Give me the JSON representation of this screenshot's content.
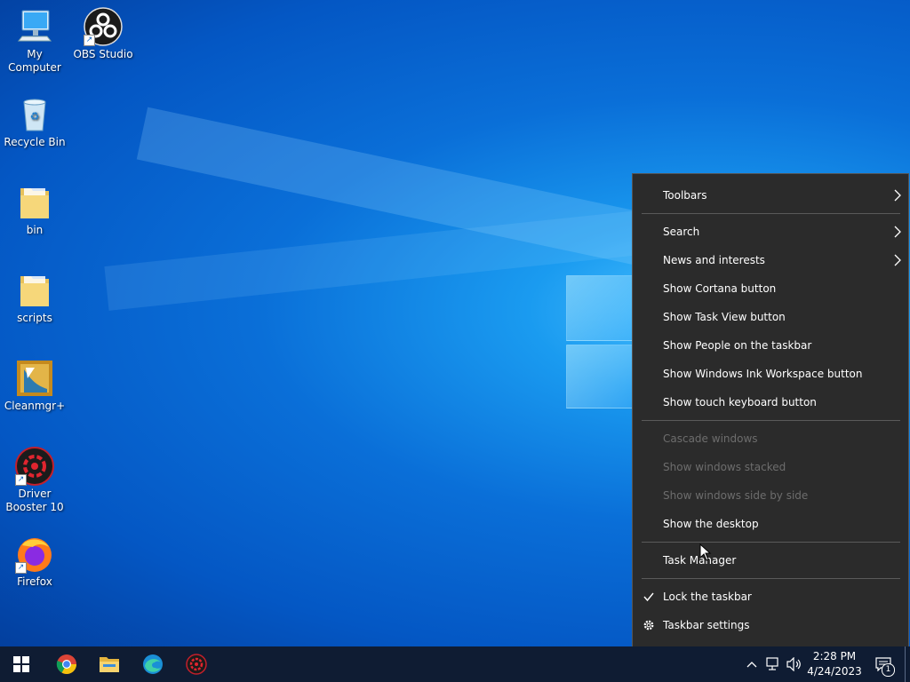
{
  "desktop": {
    "icons": [
      {
        "label": "My Computer",
        "icon": "computer-icon",
        "shortcut": false
      },
      {
        "label": "OBS Studio",
        "icon": "obs-icon",
        "shortcut": true
      },
      {
        "label": "Recycle Bin",
        "icon": "recycle-bin-icon",
        "shortcut": false
      },
      {
        "label": "bin",
        "icon": "folder-icon",
        "shortcut": false
      },
      {
        "label": "scripts",
        "icon": "folder-icon",
        "shortcut": false
      },
      {
        "label": "Cleanmgr+",
        "icon": "cleanmgr-icon",
        "shortcut": false
      },
      {
        "label": "Driver Booster 10",
        "icon": "driver-booster-icon",
        "shortcut": true
      },
      {
        "label": "Firefox",
        "icon": "firefox-icon",
        "shortcut": true
      }
    ]
  },
  "context_menu": {
    "items": [
      {
        "label": "Toolbars",
        "submenu": true,
        "enabled": true
      },
      {
        "label": "Search",
        "submenu": true,
        "enabled": true
      },
      {
        "label": "News and interests",
        "submenu": true,
        "enabled": true
      },
      {
        "label": "Show Cortana button",
        "enabled": true
      },
      {
        "label": "Show Task View button",
        "enabled": true
      },
      {
        "label": "Show People on the taskbar",
        "enabled": true
      },
      {
        "label": "Show Windows Ink Workspace button",
        "enabled": true
      },
      {
        "label": "Show touch keyboard button",
        "enabled": true
      },
      {
        "label": "Cascade windows",
        "enabled": false
      },
      {
        "label": "Show windows stacked",
        "enabled": false
      },
      {
        "label": "Show windows side by side",
        "enabled": false
      },
      {
        "label": "Show the desktop",
        "enabled": true
      },
      {
        "label": "Task Manager",
        "enabled": true
      },
      {
        "label": "Lock the taskbar",
        "checked": true,
        "enabled": true
      },
      {
        "label": "Taskbar settings",
        "icon": "gear-icon",
        "enabled": true
      }
    ]
  },
  "taskbar": {
    "pinned": [
      {
        "name": "start-button",
        "icon": "windows-logo-icon"
      },
      {
        "name": "chrome-button",
        "icon": "chrome-icon"
      },
      {
        "name": "file-explorer-button",
        "icon": "folder-icon"
      },
      {
        "name": "edge-button",
        "icon": "edge-icon"
      },
      {
        "name": "driver-booster-button",
        "icon": "driver-booster-icon"
      }
    ],
    "clock": {
      "time": "2:28 PM",
      "date": "4/24/2023"
    },
    "notifications": {
      "count": "1"
    }
  },
  "colors": {
    "menu_bg": "#2b2b2b",
    "menu_text": "#ffffff",
    "menu_disabled_text": "#6d6d6d",
    "taskbar_bg": "#0f1c33",
    "desktop_accent": "#0a6fd8"
  }
}
